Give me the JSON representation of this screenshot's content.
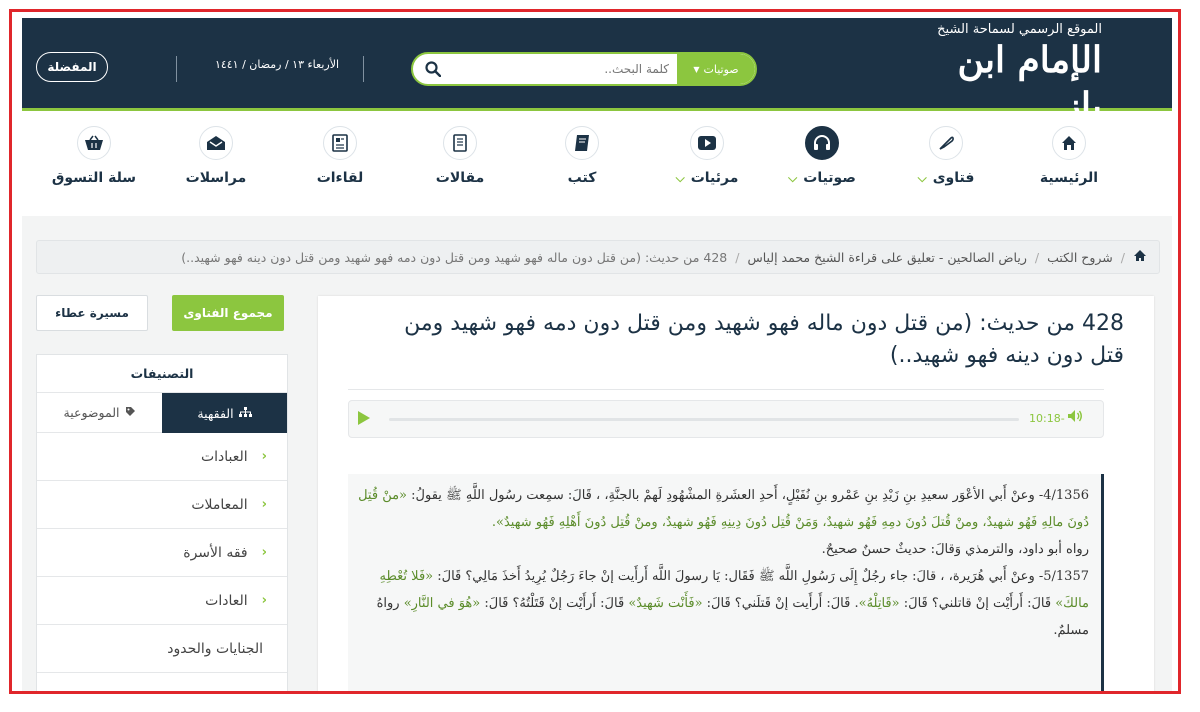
{
  "header": {
    "logo_top": "الموقع الرسمي لسماحة الشيخ",
    "logo_main": "الإمام ابن باز",
    "search_placeholder": "كلمة البحث..",
    "search_category": "صوتيات",
    "date": "الأربعاء ١٣ / رمضان / ١٤٤١",
    "favorites_label": "المفضلة"
  },
  "nav": {
    "items": [
      {
        "label": "الرئيسية",
        "icon": "home-icon",
        "dropdown": false
      },
      {
        "label": "فتاوى",
        "icon": "feather-icon",
        "dropdown": true
      },
      {
        "label": "صوتيات",
        "icon": "headphones-icon",
        "dropdown": true
      },
      {
        "label": "مرئيات",
        "icon": "video-icon",
        "dropdown": true
      },
      {
        "label": "كتب",
        "icon": "book-icon",
        "dropdown": false
      },
      {
        "label": "مقالات",
        "icon": "article-icon",
        "dropdown": false
      },
      {
        "label": "لقاءات",
        "icon": "newspaper-icon",
        "dropdown": false
      },
      {
        "label": "مراسلات",
        "icon": "mail-icon",
        "dropdown": false
      },
      {
        "label": "سلة التسوق",
        "icon": "basket-icon",
        "dropdown": false
      }
    ]
  },
  "breadcrumb": {
    "items": [
      "شروح الكتب",
      "رياض الصالحين - تعليق على قراءة الشيخ محمد إلياس",
      "428 من حديث: (من قتل دون ماله فهو شهيد ومن قتل دون دمه فهو شهيد ومن قتل دون دينه فهو شهيد..)"
    ]
  },
  "content": {
    "title": "428 من حديث: (من قتل دون ماله فهو شهيد ومن قتل دون دمه فهو شهيد ومن قتل دون دينه فهو شهيد..)",
    "player_time": "10:18-",
    "hadith": {
      "p1_a": "4/1356- وعنْ أَبي الأعْوَر سعيدِ بنِ زَيْدِ بنِ عَمْرو بنِ نُفَيْلٍ، أَحدِ العشَرةِ المشْهُودِ لَهمْ بالجنَّةِ، ، قَالَ: سمِعت رسُول اللَّهِ ﷺ يقولُ: ",
      "p1_green": "«منْ قُتِل دُونَ مالِهِ فَهُو شهيدٌ، ومنْ قُتلَ دُونَ دمِهِ فَهُو شهيدٌ، وَمَنْ قُتِل دُونَ دِينِهِ فَهُو شهيدٌ، ومنْ قُتِل دُونَ أَهْلِهِ فَهُو شهيدٌ».",
      "p1_b": "رواه أبو داود، والترمذي وَقالَ: حديثٌ حسنٌ صحيحٌ.",
      "p2_a": "5/1357- وعنْ أَبي هُرَيرة، ، قالَ: جاء رجُلٌ إِلَى رَسُولِ اللَّه ﷺ فَقَال: يَا رسولَ اللَّه أَرأَيت إنْ جاءَ رَجُلٌ يُرِيدُ أَخذَ مَالِي؟ قَالَ: ",
      "p2_g1": "«فَلا تُعْطِهِ مالكَ»",
      "p2_b": " قَالَ: أَرأَيْت إنْ قاتلني؟ قَالَ: ",
      "p2_g2": "«قَاتِلْهُ»",
      "p2_c": ". قَالَ: أَرأَيت إنْ قَتلَني؟ قَالَ: ",
      "p2_g3": "«فَأَنْت شَهيدٌ»",
      "p2_d": " قَالَ: أَرأَيْت إنْ قَتَلْتُهُ؟ قَالَ: ",
      "p2_g4": "«هُوَ في النَّارِ»",
      "p2_e": " رواهُ مسلمٌ."
    }
  },
  "sidebar": {
    "fatawa_button": "مجموع الفتاوى",
    "masira_button": "مسيرة عطاء",
    "categories_title": "التصنيفات",
    "tab_fiqh": "الفقهية",
    "tab_topical": "الموضوعية",
    "categories": [
      {
        "label": "العبادات",
        "chevron": true
      },
      {
        "label": "المعاملات",
        "chevron": true
      },
      {
        "label": "فقه الأسرة",
        "chevron": true
      },
      {
        "label": "العادات",
        "chevron": true
      },
      {
        "label": "الجنايات والحدود",
        "chevron": false
      }
    ]
  },
  "colors": {
    "header_bg": "#1c3245",
    "accent_green": "#8cc63f",
    "frame_red": "#e0262b"
  }
}
